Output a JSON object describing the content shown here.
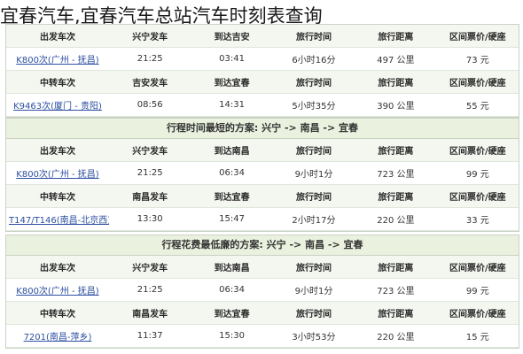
{
  "page_title": "宜春汽车,宜春汽车总站汽车时刻表查询",
  "panels": [
    {
      "title": "",
      "header1": [
        "出发车次",
        "兴宁发车",
        "到达吉安",
        "旅行时间",
        "旅行距离",
        "区间票价/硬座"
      ],
      "row1": [
        "K800次(广州 - 抚昌)",
        "21:25",
        "03:41",
        "6小时16分",
        "497 公里",
        "73 元"
      ],
      "header2": [
        "中转车次",
        "吉安发车",
        "到达宜春",
        "旅行时间",
        "旅行距离",
        "区间票价/硬座"
      ],
      "row2": [
        "K9463次(厦门 - 贵阳)",
        "08:56",
        "14:31",
        "5小时35分",
        "390 公里",
        "55 元"
      ]
    },
    {
      "title": "行程时间最短的方案: 兴宁 -> 南昌 -> 宜春",
      "header1": [
        "出发车次",
        "兴宁发车",
        "到达南昌",
        "旅行时间",
        "旅行距离",
        "区间票价/硬座"
      ],
      "row1": [
        "K800次(广州 - 抚昌)",
        "21:25",
        "06:34",
        "9小时1分",
        "723 公里",
        "99 元"
      ],
      "header2": [
        "中转车次",
        "南昌发车",
        "到达宜春",
        "旅行时间",
        "旅行距离",
        "区间票价/硬座"
      ],
      "row2": [
        "T147/T146(南昌-北京西)",
        "13:30",
        "15:47",
        "2小时17分",
        "220 公里",
        "33 元"
      ]
    },
    {
      "title": "行程花费最低廉的方案: 兴宁 -> 南昌 -> 宜春",
      "header1": [
        "出发车次",
        "兴宁发车",
        "到达南昌",
        "旅行时间",
        "旅行距离",
        "区间票价/硬座"
      ],
      "row1": [
        "K800次(广州 - 抚昌)",
        "21:25",
        "06:34",
        "9小时1分",
        "723 公里",
        "99 元"
      ],
      "header2": [
        "中转车次",
        "南昌发车",
        "到达宜春",
        "旅行时间",
        "旅行距离",
        "区间票价/硬座"
      ],
      "row2": [
        "7201(南昌-萍乡)",
        "11:37",
        "15:30",
        "3小时53分",
        "220 公里",
        "15 元"
      ]
    }
  ]
}
